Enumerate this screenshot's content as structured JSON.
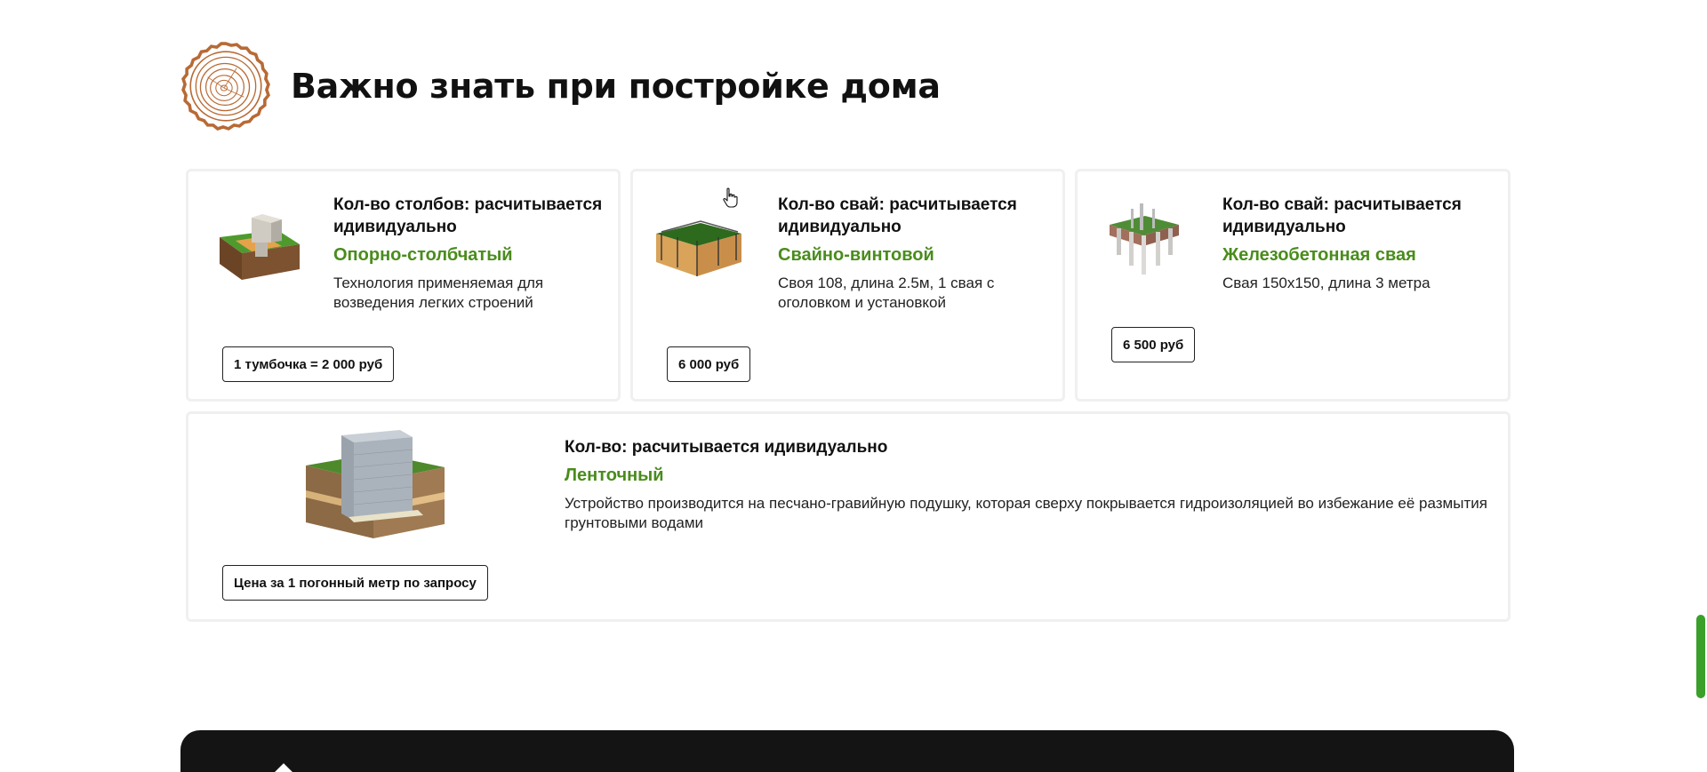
{
  "section": {
    "title": "Важно знать при постройке дома"
  },
  "cards": [
    {
      "qty": "Кол-во столбов: расчитывается идивидуально",
      "type": "Опорно-столбчатый",
      "desc": "Технология применяемая для возведения легких строений",
      "price": "1 тумбочка = 2 000 руб",
      "image": "column-foundation-image"
    },
    {
      "qty": "Кол-во свай: расчитывается идивидуально",
      "type": "Свайно-винтовой",
      "desc": "Своя 108, длина 2.5м, 1 свая с оголовком и установкой",
      "price": "6 000 руб",
      "image": "screw-pile-foundation-image"
    },
    {
      "qty": "Кол-во свай: расчитывается идивидуально",
      "type": "Железобетонная свая",
      "desc": "Свая 150х150, длина 3 метра",
      "price": "6 500 руб",
      "image": "concrete-pile-foundation-image"
    },
    {
      "qty": "Кол-во: расчитывается идивидуально",
      "type": "Ленточный",
      "desc": "Устройство производится на песчано-гравийную подушку, которая сверху покрывается гидроизоляцией во избежание её размытия грунтовыми водами",
      "price": "Цена за 1 погонный метр по запросу",
      "image": "strip-foundation-image"
    }
  ],
  "icons": {
    "logo": "wood-rings-icon",
    "cursor": "hand-pointer-icon"
  },
  "colors": {
    "accent_green": "#4a8c1c",
    "logo_brown": "#b86a35",
    "scrollbar": "#3aa02a",
    "footer": "#141414"
  }
}
